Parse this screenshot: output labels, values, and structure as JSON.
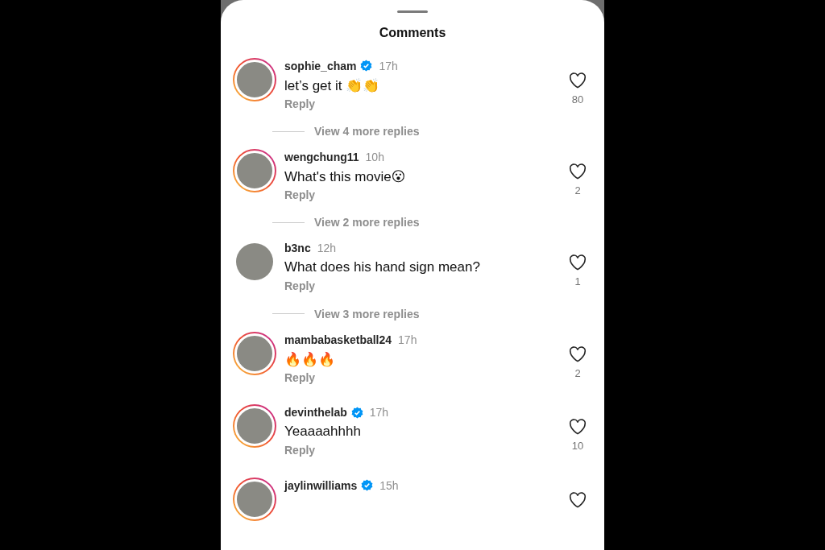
{
  "sheet": {
    "title": "Comments"
  },
  "comments": [
    {
      "username": "sophie_cham",
      "verified": true,
      "story_ring": true,
      "time": "17h",
      "text": "let’s get it 👏👏",
      "reply": "Reply",
      "likes": "80",
      "more_replies": "View 4 more replies"
    },
    {
      "username": "wengchung11",
      "verified": false,
      "story_ring": true,
      "time": "10h",
      "text": "What's this movie😮",
      "reply": "Reply",
      "likes": "2",
      "more_replies": "View 2 more replies"
    },
    {
      "username": "b3nc",
      "verified": false,
      "story_ring": false,
      "time": "12h",
      "text": "What does his hand sign mean?",
      "reply": "Reply",
      "likes": "1",
      "more_replies": "View 3 more replies"
    },
    {
      "username": "mambabasketball24",
      "verified": false,
      "story_ring": true,
      "time": "17h",
      "text": "🔥🔥🔥",
      "reply": "Reply",
      "likes": "2"
    },
    {
      "username": "devinthelab",
      "verified": true,
      "story_ring": true,
      "time": "17h",
      "text": "Yeaaaahhhh",
      "reply": "Reply",
      "likes": "10"
    },
    {
      "username": "jaylinwilliams",
      "verified": true,
      "story_ring": true,
      "time": "15h"
    }
  ]
}
